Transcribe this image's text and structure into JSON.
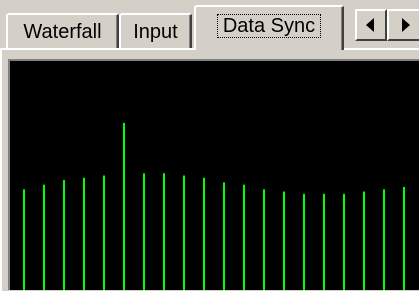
{
  "tabs": [
    {
      "label": "Waterfall",
      "selected": false
    },
    {
      "label": "Input",
      "selected": false
    },
    {
      "label": "Data Sync",
      "selected": true
    }
  ],
  "scroll_buttons": {
    "left_icon": "arrow-left-icon",
    "right_icon": "arrow-right-icon"
  },
  "colors": {
    "trace": "#00ff00",
    "background": "#000000",
    "chrome": "#d4d0c8"
  },
  "sync_display": {
    "bar_levels": [
      0.44,
      0.46,
      0.48,
      0.49,
      0.5,
      0.73,
      0.51,
      0.51,
      0.5,
      0.49,
      0.47,
      0.46,
      0.44,
      0.43,
      0.42,
      0.42,
      0.42,
      0.43,
      0.44,
      0.45
    ]
  }
}
